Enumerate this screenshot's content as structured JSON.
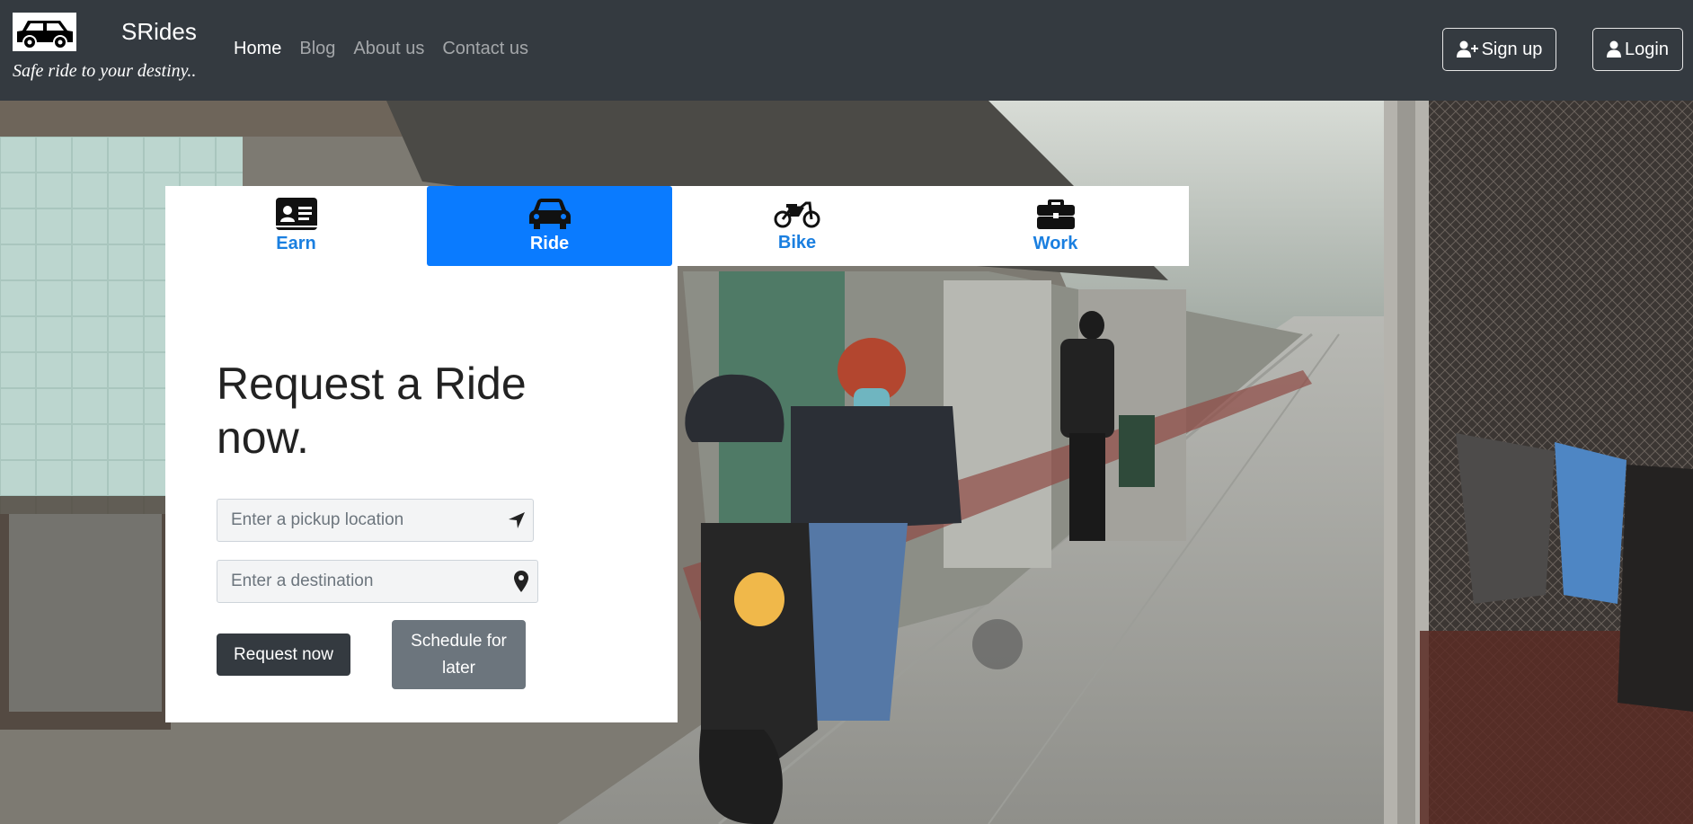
{
  "brand": {
    "name": "SRides",
    "tagline": "Safe ride to your destiny..",
    "logo_icon": "car-icon"
  },
  "nav": {
    "links": [
      {
        "label": "Home",
        "active": true
      },
      {
        "label": "Blog",
        "active": false
      },
      {
        "label": "About us",
        "active": false
      },
      {
        "label": "Contact us",
        "active": false
      }
    ],
    "signup_label": "Sign up",
    "login_label": "Login"
  },
  "tabs": [
    {
      "label": "Earn",
      "icon": "id-card-icon",
      "active": false
    },
    {
      "label": "Ride",
      "icon": "car-icon",
      "active": true
    },
    {
      "label": "Bike",
      "icon": "motorcycle-icon",
      "active": false
    },
    {
      "label": "Work",
      "icon": "briefcase-icon",
      "active": false
    }
  ],
  "card": {
    "title": "Request a Ride now.",
    "pickup_placeholder": "Enter a pickup location",
    "destination_placeholder": "Enter a destination",
    "request_label": "Request now",
    "schedule_label": "Schedule for later"
  },
  "colors": {
    "navbar": "#343a40",
    "accent": "#0a7bff",
    "tab_text": "#1a7fe0",
    "secondary": "#6c757d"
  }
}
